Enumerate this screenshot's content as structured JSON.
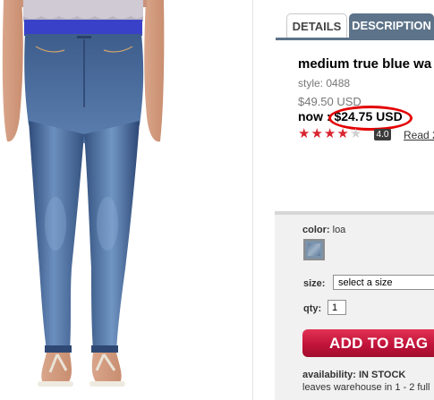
{
  "tabs": {
    "details_label": "DETAILS",
    "description_label": "DESCRIPTION"
  },
  "product": {
    "title": "medium true blue wa",
    "style": "style: 0488",
    "old_price": "$49.50 USD",
    "now_prefix": "now :",
    "now_price": "$24.75 USD",
    "rating_stars": 4,
    "rating_max": 5,
    "rating_value": "4.0",
    "reviews_link": "Read 2"
  },
  "options": {
    "color_label": "color:",
    "color_value": "loa",
    "size_label": "size:",
    "size_placeholder": "select a size",
    "qty_label": "qty:",
    "qty_value": "1",
    "add_button": "ADD TO BAG",
    "availability_label": "availability:",
    "availability_value": "IN STOCK",
    "leaves_text": "leaves warehouse in 1 - 2 full"
  },
  "colors": {
    "tab_active": "#5d7389",
    "price_highlight": "#e30000",
    "star": "#d8242f",
    "add_button": "#c2143a",
    "denim": "#4a6d9c"
  },
  "icons": {
    "product_image": "jeans-photo",
    "star": "star-icon",
    "swatch": "color-swatch"
  }
}
